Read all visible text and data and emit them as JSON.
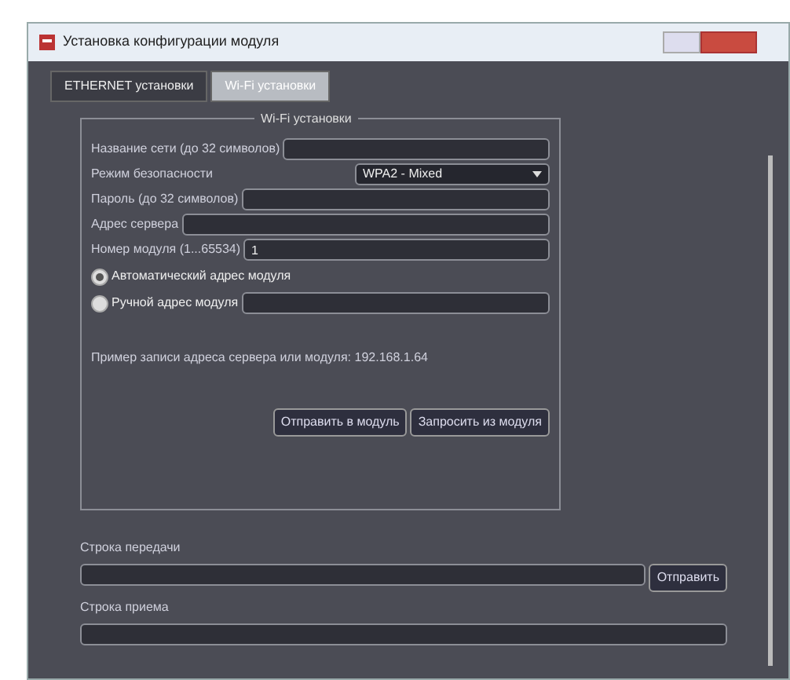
{
  "window": {
    "title": "Установка конфигурации модуля"
  },
  "tabs": [
    {
      "label": "ETHERNET установки",
      "selected": false
    },
    {
      "label": "Wi-Fi установки",
      "selected": true
    }
  ],
  "group": {
    "title": "Wi-Fi установки",
    "fields": [
      {
        "kind": "text",
        "label": "Название сети (до 32 символов)"
      },
      {
        "kind": "select",
        "label": "Режим безопасности",
        "value": "WPA2 - Mixed"
      },
      {
        "kind": "text",
        "label": "Пароль (до 32 символов)"
      },
      {
        "kind": "text",
        "label": "Адрес сервера"
      },
      {
        "kind": "text",
        "label": "Номер модуля (1...65534)",
        "value": "1"
      }
    ],
    "radios": [
      {
        "label": "Автоматический адрес модуля",
        "selected": true,
        "kind": "plain"
      },
      {
        "label": "Ручной адрес модуля",
        "selected": false,
        "kind": "with_field"
      }
    ],
    "hint": "Пример записи адреса сервера или модуля: 192.168.1.64",
    "buttons": [
      "Отправить в модуль",
      "Запросить из модуля"
    ]
  },
  "transmit": {
    "label": "Строка передачи",
    "button": "Отправить"
  },
  "receive": {
    "label": "Строка приема"
  }
}
